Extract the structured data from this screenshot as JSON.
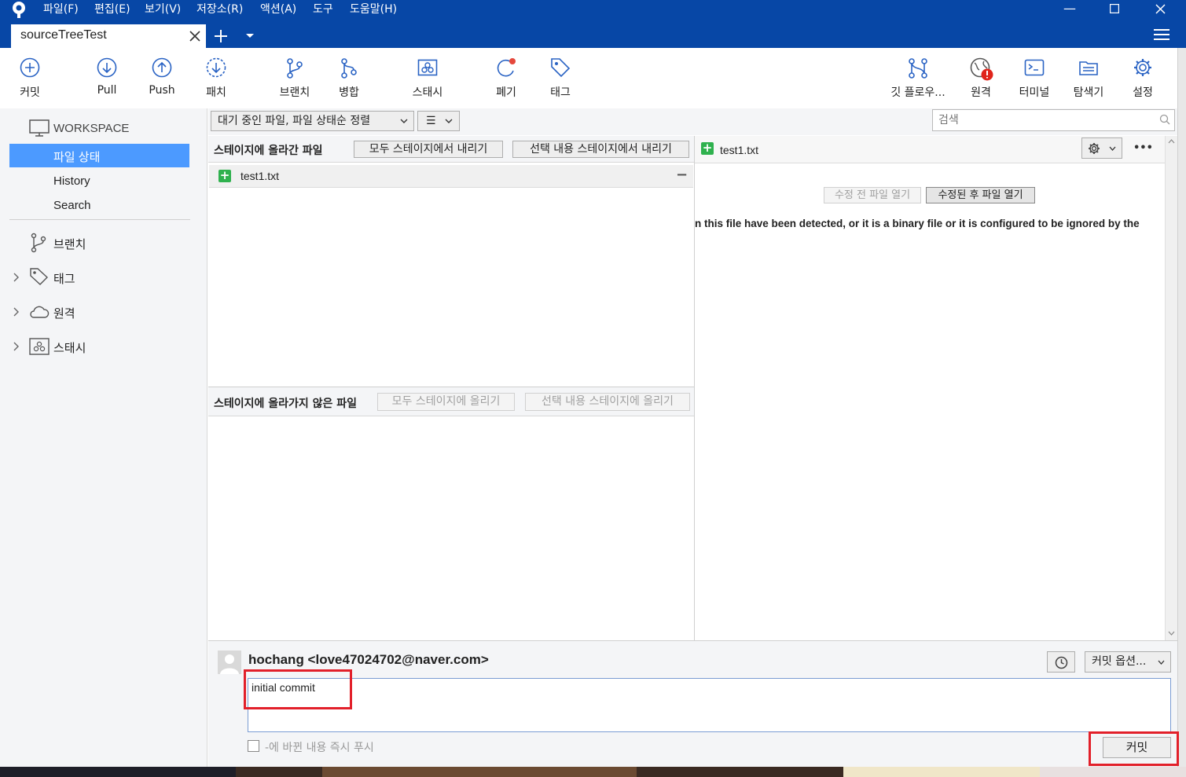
{
  "menu": [
    "파일(F)",
    "편집(E)",
    "보기(V)",
    "저장소(R)",
    "액션(A)",
    "도구",
    "도움말(H)"
  ],
  "tab": {
    "title": "sourceTreeTest"
  },
  "toolbar": {
    "commit": "커밋",
    "pull": "Pull",
    "push": "Push",
    "fetch": "패치",
    "branch": "브랜치",
    "merge": "병합",
    "stash": "스태시",
    "discard": "폐기",
    "tag": "태그",
    "gitflow": "깃 플로우...",
    "remote": "원격",
    "terminal": "터미널",
    "explorer": "탐색기",
    "settings": "설정"
  },
  "sidebar": {
    "workspace": "WORKSPACE",
    "items": [
      "파일 상태",
      "History",
      "Search"
    ],
    "groups": [
      "브랜치",
      "태그",
      "원격",
      "스태시"
    ]
  },
  "filter": {
    "sort": "대기 중인 파일, 파일 상태순 정렬",
    "view_icon": "☰",
    "search_placeholder": "검색"
  },
  "staged": {
    "title": "스테이지에 올라간 파일",
    "unstage_all": "모두 스테이지에서 내리기",
    "unstage_selected": "선택 내용 스테이지에서 내리기",
    "files": [
      "test1.txt"
    ],
    "remove_icon": "−"
  },
  "unstaged": {
    "title": "스테이지에 올라가지 않은 파일",
    "stage_all": "모두 스테이지에 올리기",
    "stage_selected": "선택 내용 스테이지에 올리기"
  },
  "diff": {
    "file": "test1.txt",
    "open_before": "수정 전 파일 열기",
    "open_after": "수정된 후 파일 열기",
    "message": "n this file have been detected, or it is a binary file or it is configured to be ignored by the",
    "more": "•••"
  },
  "commit_panel": {
    "author": "hochang <love47024702@naver.com>",
    "message": "initial commit",
    "options": "커밋 옵션...",
    "push_label": "-에 바뀐 내용 즉시 푸시",
    "commit_button": "커밋"
  },
  "colors": {
    "titlebar": "#0747a6",
    "selected": "#4c9aff",
    "highlight": "#e2202a",
    "added": "#2fb14e"
  }
}
